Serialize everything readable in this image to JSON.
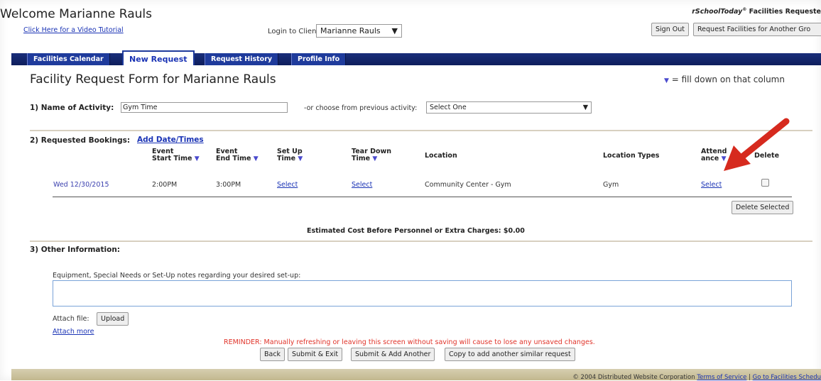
{
  "header": {
    "welcome": "Welcome Marianne Rauls",
    "tutorial_link": "Click Here for a Video Tutorial",
    "login_label": "Login to Client:",
    "client_selected": "Marianne Rauls",
    "brand_logo": "rSchoolToday",
    "brand_tm": "®",
    "brand_text": " Facilities Requeste",
    "sign_out": "Sign Out",
    "request_other": "Request Facilities for Another Gro"
  },
  "tabs": [
    {
      "label": "Facilities Calendar"
    },
    {
      "label": "New Request"
    },
    {
      "label": "Request History"
    },
    {
      "label": "Profile Info"
    }
  ],
  "form": {
    "title": "Facility Request Form for Marianne Rauls",
    "filldown_note": "= fill down on that column",
    "section1_label": "1) Name of Activity:",
    "activity_value": "Gym Time",
    "prev_label": "-or choose from previous activity:",
    "prev_select": "Select One",
    "section2_label": "2) Requested Bookings:",
    "add_date_link": "Add Date/Times",
    "section3_label": "3) Other Information:",
    "equip_label": "Equipment, Special Needs or Set-Up notes regarding your desired set-up:",
    "attach_label": "Attach file:",
    "upload_button": "Upload",
    "attach_more": "Attach more",
    "estimated_cost": "Estimated Cost Before Personnel or Extra Charges: $0.00",
    "delete_selected": "Delete Selected",
    "reminder": "REMINDER: Manually refreshing or leaving this screen without saving will cause to lose any unsaved changes."
  },
  "table": {
    "headers": {
      "start_1": "Event",
      "start_2": "Start Time",
      "end_1": "Event",
      "end_2": "End Time",
      "setup_1": "Set Up",
      "setup_2": "Time",
      "teardown_1": "Tear Down",
      "teardown_2": "Time",
      "location": "Location",
      "location_types": "Location Types",
      "attend_1": "Attend",
      "attend_2": "ance",
      "delete": "Delete"
    },
    "row": {
      "date": "Wed 12/30/2015",
      "start": "2:00PM",
      "end": "3:00PM",
      "setup": "Select",
      "teardown": "Select",
      "location": "Community Center - Gym",
      "location_type": "Gym",
      "attendance": "Select"
    }
  },
  "actions": {
    "back": "Back",
    "submit_exit": "Submit & Exit",
    "submit_add": "Submit & Add Another",
    "copy": "Copy to add another similar request"
  },
  "footer": {
    "copyright": "© 2004 Distributed Website Corporation",
    "terms": "Terms of Service",
    "separator": "|",
    "go_to": "Go to Facilities Schedu"
  },
  "icons": {
    "filldown": "filldown-triangle-icon",
    "dropdown": "dropdown-arrow-icon",
    "annotation_arrow": "red-arrow-icon"
  },
  "colors": {
    "tab_bar": "#1a2e7a",
    "link": "#1a33b5",
    "reminder": "#e0342a",
    "annotation_arrow": "#d62a1e"
  }
}
